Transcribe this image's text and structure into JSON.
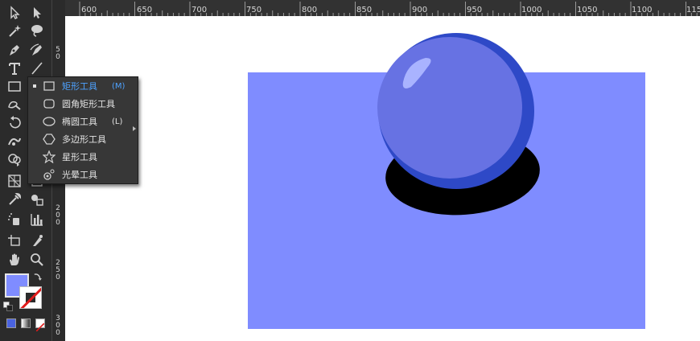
{
  "ruler": {
    "h_labels": [
      "600",
      "650",
      "700",
      "750",
      "800",
      "850",
      "900",
      "950",
      "1000",
      "1050",
      "1100",
      "115"
    ],
    "v_labels": [
      "5\n0",
      "2\n0\n0",
      "2\n5\n0",
      "3\n0\n0"
    ]
  },
  "flyout": {
    "items": [
      {
        "label": "矩形工具",
        "shortcut": "(M)",
        "active": true,
        "icon": "rectangle-icon"
      },
      {
        "label": "圆角矩形工具",
        "shortcut": "",
        "active": false,
        "icon": "rounded-rectangle-icon"
      },
      {
        "label": "椭圆工具",
        "shortcut": "(L)",
        "active": false,
        "icon": "ellipse-icon"
      },
      {
        "label": "多边形工具",
        "shortcut": "",
        "active": false,
        "icon": "polygon-icon"
      },
      {
        "label": "星形工具",
        "shortcut": "",
        "active": false,
        "icon": "star-icon"
      },
      {
        "label": "光晕工具",
        "shortcut": "",
        "active": false,
        "icon": "flare-icon"
      }
    ]
  },
  "colors": {
    "fill": "#7f8cff",
    "artboard_bg": "#7f8cff",
    "sphere_main": "#6772e3",
    "sphere_shade": "#2e49c7",
    "highlight": "#a9b3ff",
    "shadow": "#000000"
  },
  "toolbar": {
    "icons": [
      "selection-icon",
      "direct-selection-icon",
      "magic-wand-icon",
      "lasso-icon",
      "pen-icon",
      "curvature-icon",
      "type-icon",
      "line-icon",
      "rectangle-tool-icon",
      "paintbrush-icon",
      "rotate-icon",
      "width-icon",
      "shape-builder-icon",
      "perspective-icon",
      "eyedropper-icon",
      "blend-icon",
      "symbol-sprayer-icon",
      "graph-icon",
      "artboard-icon",
      "slice-icon",
      "hand-icon",
      "zoom-icon"
    ]
  }
}
